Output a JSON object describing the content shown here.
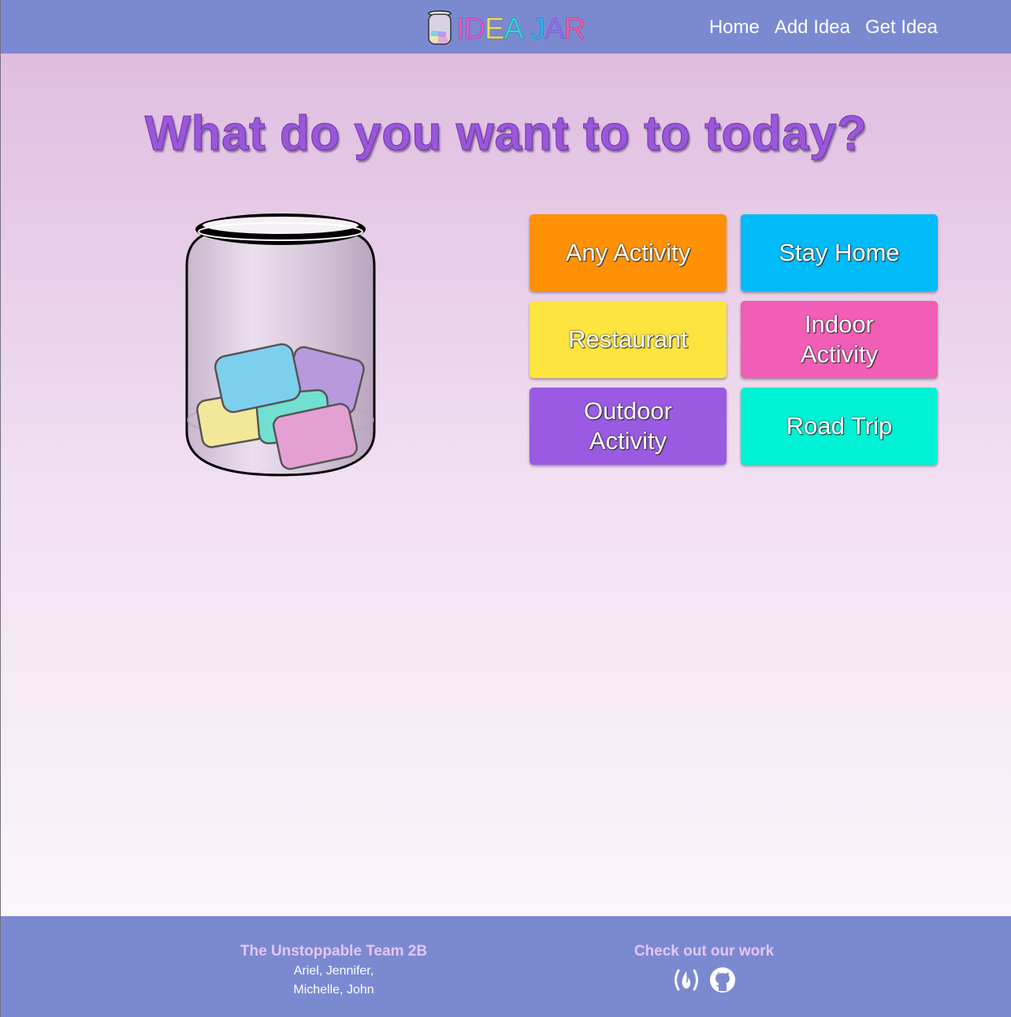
{
  "brand": {
    "letters": [
      {
        "char": "I",
        "color": "#f05ab4"
      },
      {
        "char": "D",
        "color": "#e455d2"
      },
      {
        "char": "E",
        "color": "#f6e14a"
      },
      {
        "char": "A",
        "color": "#21e0d0"
      },
      {
        "char": " ",
        "color": "#ffffff"
      },
      {
        "char": "J",
        "color": "#22b8f0"
      },
      {
        "char": "A",
        "color": "#9a6af0"
      },
      {
        "char": "R",
        "color": "#f05aa0"
      }
    ],
    "icon": "jar-logo-icon"
  },
  "nav": {
    "links": [
      "Home",
      "Add Idea",
      "Get Idea"
    ]
  },
  "main": {
    "headline": "What do you want to to today?",
    "categories": [
      {
        "label": "Any Activity",
        "color": "#ff9106"
      },
      {
        "label": "Stay Home",
        "color": "#00bbf8"
      },
      {
        "label": "Restaurant",
        "color": "#fee43e"
      },
      {
        "label": "Indoor Activity",
        "color": "#f25db6"
      },
      {
        "label": "Outdoor Activity",
        "color": "#9a5ae1"
      },
      {
        "label": "Road Trip",
        "color": "#00f2d4"
      }
    ]
  },
  "footer": {
    "team_title": "The Unstoppable Team 2B",
    "team_members": "Ariel, Jennifer, Michelle, John",
    "work_title": "Check out our work",
    "icons": [
      "freecodecamp-icon",
      "github-icon"
    ]
  },
  "colors": {
    "navbar": "#7b89d1",
    "headline": "#9b56db",
    "footer_accent": "#e6c6f4"
  }
}
